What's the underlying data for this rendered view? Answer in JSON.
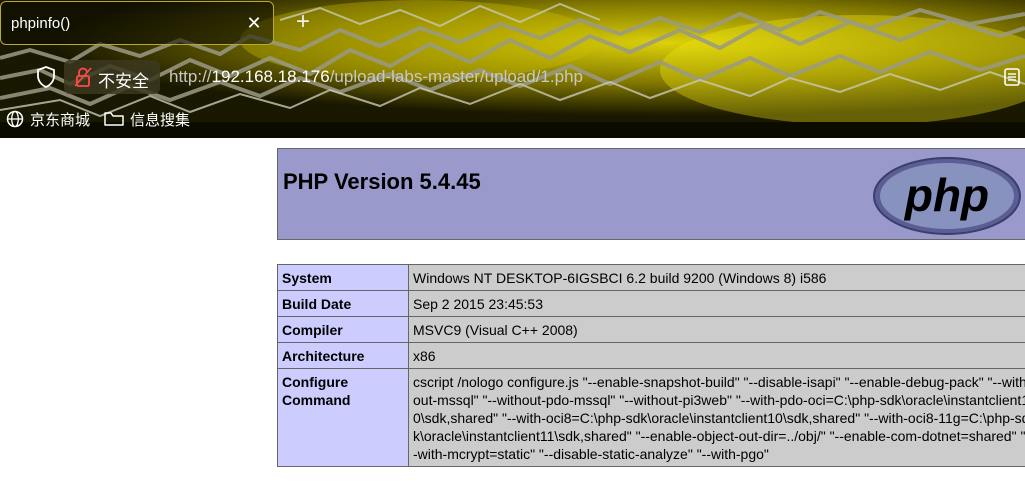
{
  "browser": {
    "tab_title": "phpinfo()",
    "tab_close": "✕",
    "new_tab": "+",
    "security_label": "不安全",
    "url_scheme": "http://",
    "url_host": "192.168.18.176",
    "url_path": "/upload-labs-master/upload/1.php",
    "bookmarks": [
      {
        "label": "京东商城",
        "icon": "globe-icon"
      },
      {
        "label": "信息搜集",
        "icon": "folder-icon"
      }
    ],
    "accent_color": "#b7aa2e"
  },
  "phpinfo": {
    "version_title": "PHP Version 5.4.45",
    "logo_text": "php",
    "header_color": "#9999cc",
    "key_color": "#ccccff",
    "value_color": "#cccccc",
    "rows": [
      {
        "key": "System",
        "value": "Windows NT DESKTOP-6IGSBCI 6.2 build 9200 (Windows 8) i586"
      },
      {
        "key": "Build Date",
        "value": "Sep 2 2015 23:45:53"
      },
      {
        "key": "Compiler",
        "value": "MSVC9 (Visual C++ 2008)"
      },
      {
        "key": "Architecture",
        "value": "x86"
      },
      {
        "key": "Configure Command",
        "value": "cscript /nologo configure.js \"--enable-snapshot-build\" \"--disable-isapi\" \"--enable-debug-pack\" \"--without-mssql\" \"--without-pdo-mssql\" \"--without-pi3web\" \"--with-pdo-oci=C:\\php-sdk\\oracle\\instantclient10\\sdk,shared\" \"--with-oci8=C:\\php-sdk\\oracle\\instantclient10\\sdk,shared\" \"--with-oci8-11g=C:\\php-sdk\\oracle\\instantclient11\\sdk,shared\" \"--enable-object-out-dir=../obj/\" \"--enable-com-dotnet=shared\" \"--with-mcrypt=static\" \"--disable-static-analyze\" \"--with-pgo\""
      }
    ]
  }
}
